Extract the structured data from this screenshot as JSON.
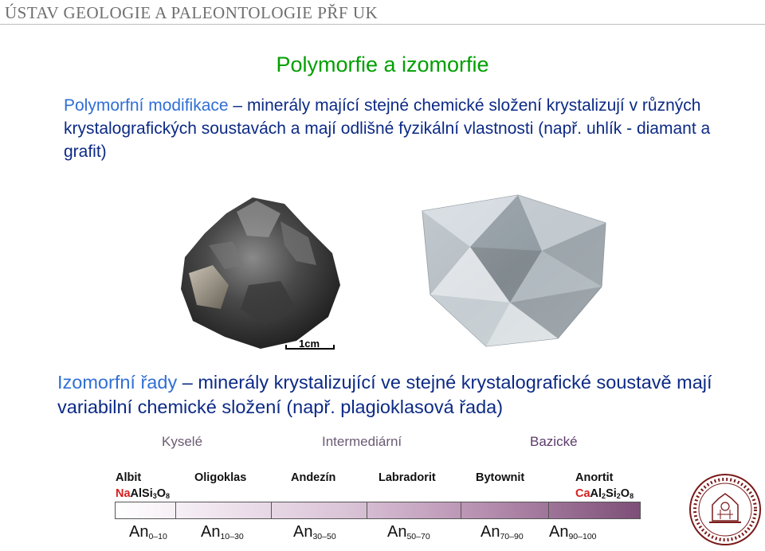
{
  "header": {
    "text": "ÚSTAV GEOLOGIE A PALEONTOLOGIE PŘF UK"
  },
  "title": "Polymorfie a izomorfie",
  "paragraph1": {
    "term": "Polymorfní modifikace",
    "dash": " – ",
    "text": "minerály mající stejné chemické složení krystalizují v různých krystalografických soustavách a mají odlišné fyzikální vlastnosti (např. uhlík - diamant a grafit)"
  },
  "scale_label": "1cm",
  "paragraph2": {
    "term": "Izomorfní řady",
    "dash": " – ",
    "text": "minerály krystalizující ve stejné krystalografické soustavě mají variabilní chemické složení (např. plagioklasová řada)"
  },
  "series": {
    "categories": {
      "acid": "Kyselé",
      "intermediate": "Intermediární",
      "basic": "Bazické"
    },
    "minerals": [
      "Albit",
      "Oligoklas",
      "Andezín",
      "Labradorit",
      "Bytownit",
      "Anortit"
    ],
    "albit_formula": {
      "red": "Na",
      "rest": "AlSi",
      "s1": "3",
      "o": "O",
      "s2": "8"
    },
    "anortit_formula": {
      "red": "Ca",
      "rest": "Al",
      "s1": "2",
      "mid": "Si",
      "s2": "2",
      "o": "O",
      "s3": "8"
    },
    "an_ranges": [
      {
        "base": "An",
        "sub": "0–10"
      },
      {
        "base": "An",
        "sub": "10–30"
      },
      {
        "base": "An",
        "sub": "30–50"
      },
      {
        "base": "An",
        "sub": "50–70"
      },
      {
        "base": "An",
        "sub": "70–90"
      },
      {
        "base": "An",
        "sub": "90–100"
      }
    ]
  },
  "colors": {
    "title": "#00a000",
    "text": "#0c2a86",
    "term": "#2f6fd6",
    "cation": "#d42020"
  },
  "images": [
    "graphite-crystal",
    "diamond-gem",
    "charles-university-seal"
  ]
}
